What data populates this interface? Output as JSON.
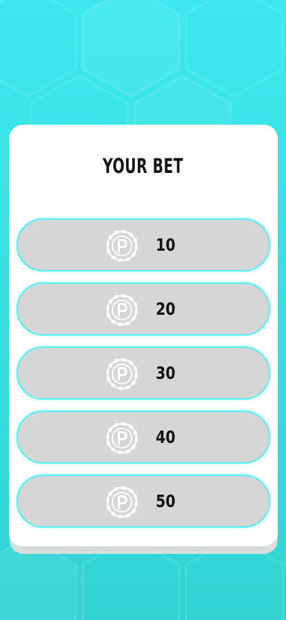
{
  "screen": {
    "title": "YOUR BET"
  },
  "colors": {
    "background": "#3ee8ec",
    "card": "#ffffff",
    "option_fill": "#d6d6d6",
    "option_border": "#4ef3f5",
    "text": "#151515"
  },
  "bet_options": [
    {
      "amount": "10",
      "icon": "poker-chip-icon"
    },
    {
      "amount": "20",
      "icon": "poker-chip-icon"
    },
    {
      "amount": "30",
      "icon": "poker-chip-icon"
    },
    {
      "amount": "40",
      "icon": "poker-chip-icon"
    },
    {
      "amount": "50",
      "icon": "poker-chip-icon"
    }
  ]
}
